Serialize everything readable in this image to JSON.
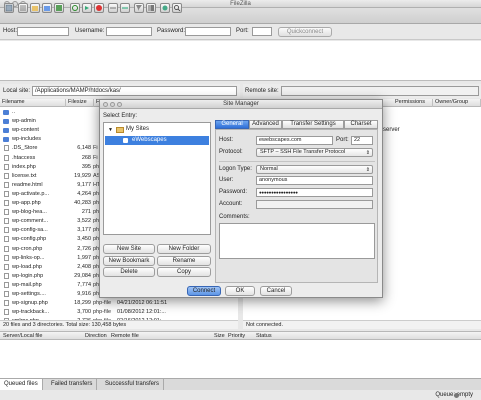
{
  "window": {
    "title": "FileZilla"
  },
  "quickconnect": {
    "host_label": "Host:",
    "username_label": "Username:",
    "password_label": "Password:",
    "port_label": "Port:",
    "host_value": "",
    "username_value": "",
    "password_value": "",
    "port_value": "",
    "button_label": "Quickconnect"
  },
  "local_site": {
    "label": "Local site:",
    "path": "/Applications/MAMP/htdocs/kas/"
  },
  "remote_site": {
    "label": "Remote site:",
    "path": ""
  },
  "local_list": {
    "columns": [
      "Filename",
      "Filesize",
      "Fi"
    ],
    "rows": [
      {
        "name": "..",
        "size": "",
        "type": "",
        "icon": "up"
      },
      {
        "name": "wp-admin",
        "size": "",
        "type": "",
        "icon": "dir"
      },
      {
        "name": "wp-content",
        "size": "",
        "type": "",
        "icon": "dir"
      },
      {
        "name": "wp-includes",
        "size": "",
        "type": "",
        "icon": "dir"
      },
      {
        "name": ".DS_Store",
        "size": "6,148",
        "type": "Fi",
        "icon": "doc"
      },
      {
        "name": ".htaccess",
        "size": "268",
        "type": "Fi",
        "icon": "doc"
      },
      {
        "name": "index.php",
        "size": "395",
        "type": "ph",
        "icon": "doc"
      },
      {
        "name": "license.txt",
        "size": "19,929",
        "type": "AS",
        "icon": "doc"
      },
      {
        "name": "readme.html",
        "size": "9,177",
        "type": "HT",
        "icon": "doc"
      },
      {
        "name": "wp-activate.p...",
        "size": "4,264",
        "type": "ph",
        "icon": "doc"
      },
      {
        "name": "wp-app.php",
        "size": "40,283",
        "type": "ph",
        "icon": "doc"
      },
      {
        "name": "wp-blog-hea...",
        "size": "271",
        "type": "ph",
        "icon": "doc"
      },
      {
        "name": "wp-comment...",
        "size": "3,522",
        "type": "ph",
        "icon": "doc"
      },
      {
        "name": "wp-config-sa...",
        "size": "3,177",
        "type": "ph",
        "icon": "doc"
      },
      {
        "name": "wp-config.php",
        "size": "3,450",
        "type": "ph",
        "icon": "doc"
      },
      {
        "name": "wp-cron.php",
        "size": "2,726",
        "type": "ph",
        "icon": "doc"
      },
      {
        "name": "wp-links-op...",
        "size": "1,997",
        "type": "ph",
        "icon": "doc"
      },
      {
        "name": "wp-load.php",
        "size": "2,408",
        "type": "ph",
        "icon": "doc"
      },
      {
        "name": "wp-login.php",
        "size": "29,084",
        "type": "ph",
        "icon": "doc"
      },
      {
        "name": "wp-mail.php",
        "size": "7,774",
        "type": "ph",
        "icon": "doc"
      },
      {
        "name": "wp-settings....",
        "size": "9,916",
        "type": "ph",
        "icon": "doc"
      },
      {
        "name": "wp-signup.php",
        "size": "18,299",
        "type": "php-file",
        "date": "04/21/2012 06:11:51",
        "icon": "doc"
      },
      {
        "name": "wp-trackback...",
        "size": "3,700",
        "type": "php-file",
        "date": "01/08/2012 12:01:...",
        "icon": "doc"
      },
      {
        "name": "xmlrpc.php",
        "size": "2,726",
        "type": "php-file",
        "date": "02/16/2012 12:01:...",
        "icon": "doc"
      }
    ],
    "status": "20 files and 3 directories. Total size: 130,458 bytes"
  },
  "remote_list": {
    "columns": [
      "Permissions",
      "Owner/Group"
    ],
    "body_text": "server",
    "status": "Not connected."
  },
  "queue": {
    "columns": [
      "Server/Local file",
      "Direction",
      "Remote file",
      "Size",
      "Priority",
      "Status"
    ],
    "tabs": [
      "Queued files",
      "Failed transfers",
      "Successful transfers"
    ],
    "footer": "Queue: empty"
  },
  "site_manager": {
    "title": "Site Manager",
    "select_entry_label": "Select Entry:",
    "tree_root": "My Sites",
    "tree_item": "eWebscapes",
    "buttons": {
      "new_site": "New Site",
      "new_folder": "New Folder",
      "new_bookmark": "New Bookmark",
      "rename": "Rename",
      "delete": "Delete",
      "copy": "Copy",
      "connect": "Connect",
      "ok": "OK",
      "cancel": "Cancel"
    },
    "tabs": [
      "General",
      "Advanced",
      "Transfer Settings",
      "Charset"
    ],
    "general": {
      "host_label": "Host:",
      "host_value": "ewebscapes.com",
      "port_label": "Port:",
      "port_value": "22",
      "protocol_label": "Protocol:",
      "protocol_value": "SFTP – SSH File Transfer Protocol",
      "logon_label": "Logon Type:",
      "logon_value": "Normal",
      "user_label": "User:",
      "user_value": "anonymous",
      "password_label": "Password:",
      "password_value": "●●●●●●●●●●●●●●●●",
      "account_label": "Account:",
      "account_value": "",
      "comments_label": "Comments:"
    }
  },
  "colors": {
    "accent": "#2f6fd8",
    "selection": "#3d80df"
  }
}
